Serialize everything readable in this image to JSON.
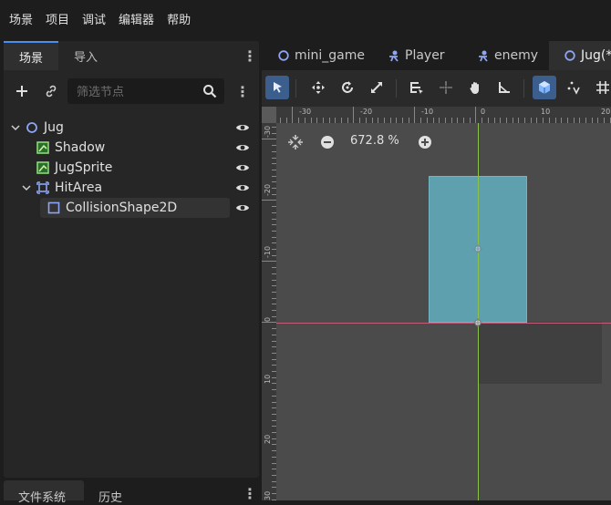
{
  "menu": [
    "场景",
    "项目",
    "调试",
    "编辑器",
    "帮助"
  ],
  "scene_dock": {
    "tabs": [
      "场景",
      "导入"
    ],
    "filter_placeholder": "筛选节点",
    "tree": [
      {
        "label": "Jug",
        "icon": "node2d-icon",
        "depth": 0,
        "expanded": true
      },
      {
        "label": "Shadow",
        "icon": "sprite-icon",
        "depth": 1
      },
      {
        "label": "JugSprite",
        "icon": "sprite-icon",
        "depth": 1
      },
      {
        "label": "HitArea",
        "icon": "area2d-icon",
        "depth": 1,
        "expanded": true
      },
      {
        "label": "CollisionShape2D",
        "icon": "collision-shape-icon",
        "depth": 2,
        "selected": true
      }
    ]
  },
  "bottom_dock": {
    "tabs": [
      "文件系统",
      "历史"
    ]
  },
  "editor_tabs": [
    {
      "label": "mini_game",
      "icon": "node-circle-icon"
    },
    {
      "label": "Player",
      "icon": "character-icon"
    },
    {
      "label": "enemy",
      "icon": "character-icon"
    },
    {
      "label": "Jug(*)",
      "icon": "node-circle-icon",
      "active": true
    }
  ],
  "viewport": {
    "zoom": "672.8 %",
    "ruler_top_labels": [
      "-30",
      "-20",
      "-10",
      "0",
      "10",
      "20"
    ],
    "ruler_left_labels": [
      "-30",
      "-20",
      "-10",
      "0",
      "10",
      "20",
      "30"
    ]
  },
  "colors": {
    "accent": "#4c8ef0",
    "collision_shape": "#5ea0ad",
    "x_axis": "#c35a78",
    "y_axis": "#8bc34a"
  }
}
